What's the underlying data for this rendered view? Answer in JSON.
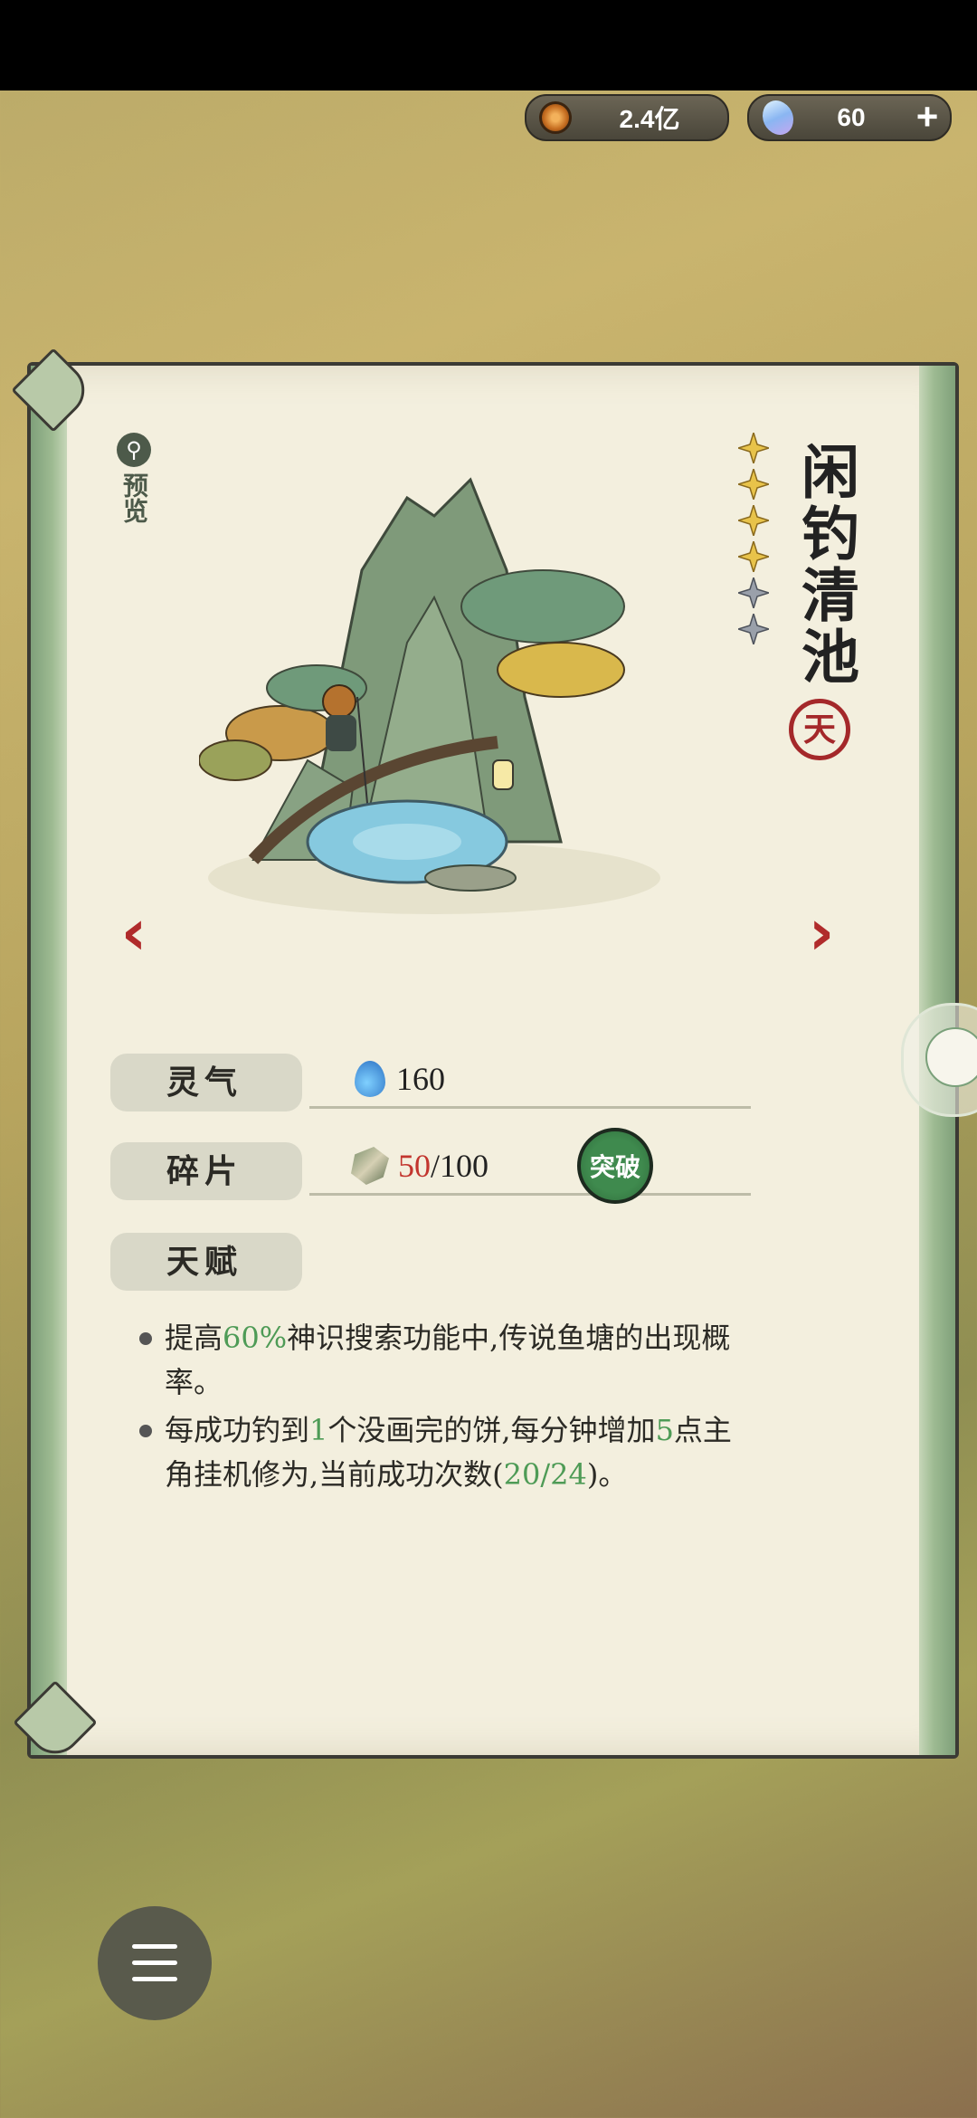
{
  "resources": {
    "coins": "2.4亿",
    "coin_icon": "copper-coin-icon",
    "gems": "60",
    "gem_icon": "spirit-crystal-icon",
    "add_label": "+"
  },
  "card": {
    "preview_label": "预览",
    "title": "闲钓清池",
    "rank_label": "天",
    "stars_filled": 4,
    "stars_total": 6,
    "stats": {
      "spirit_label": "灵气",
      "spirit_value": "160",
      "fragments_label": "碎片",
      "fragments_current": "50",
      "fragments_total": "/100",
      "breakthrough_label": "突破",
      "talent_label": "天赋"
    },
    "talents": [
      {
        "pre": "提高",
        "hl": "60%",
        "post": "神识搜索功能中,传说鱼塘的出现概率。"
      },
      {
        "pre": "每成功钓到",
        "hl": "1",
        "mid": "个没画完的饼,每分钟增加",
        "hl2": "5",
        "mid2": "点主角挂机修为,当前成功次数(",
        "hl3": "20/24",
        "post": ")。"
      }
    ]
  },
  "colors": {
    "accent_red": "#b02b2b",
    "highlight_green": "#4e9b56",
    "rank_red": "#a4282a"
  }
}
